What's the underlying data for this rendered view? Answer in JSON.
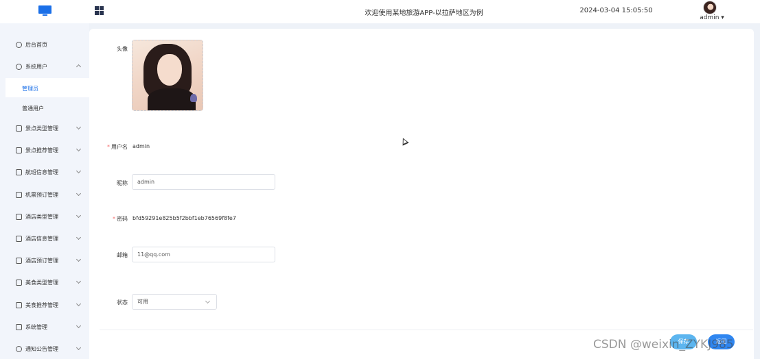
{
  "header": {
    "title": "欢迎使用某地旅游APP-以拉萨地区为例",
    "datetime": "2024-03-04 15:05:50",
    "user_name": "admin"
  },
  "sidebar": {
    "items": [
      {
        "label": "后台首页",
        "icon": "clock-icon",
        "expandable": false
      },
      {
        "label": "系统用户",
        "icon": "user-icon",
        "expandable": true,
        "expanded": true,
        "children": [
          {
            "label": "管理员",
            "active": true
          },
          {
            "label": "普通用户",
            "active": false
          }
        ]
      },
      {
        "label": "景点类型管理",
        "icon": "list-icon",
        "expandable": true
      },
      {
        "label": "景点推荐管理",
        "icon": "list-icon",
        "expandable": true
      },
      {
        "label": "航班信息管理",
        "icon": "list-icon",
        "expandable": true
      },
      {
        "label": "机票预订管理",
        "icon": "list-icon",
        "expandable": true
      },
      {
        "label": "酒店类型管理",
        "icon": "list-icon",
        "expandable": true
      },
      {
        "label": "酒店信息管理",
        "icon": "list-icon",
        "expandable": true
      },
      {
        "label": "酒店预订管理",
        "icon": "list-icon",
        "expandable": true
      },
      {
        "label": "美食类型管理",
        "icon": "list-icon",
        "expandable": true
      },
      {
        "label": "美食推荐管理",
        "icon": "list-icon",
        "expandable": true
      },
      {
        "label": "系统管理",
        "icon": "folder-icon",
        "expandable": true
      },
      {
        "label": "通知公告管理",
        "icon": "sun-icon",
        "expandable": true
      }
    ]
  },
  "form": {
    "avatar_label": "头像",
    "username_label": "用户名",
    "username_value": "admin",
    "nickname_label": "昵称",
    "nickname_value": "admin",
    "password_label": "密码",
    "password_value": "bfd59291e825b5f2bbf1eb76569f8fe7",
    "email_label": "邮箱",
    "email_value": "11@qq.com",
    "status_label": "状态",
    "status_value": "可用",
    "save_label": "保存",
    "back_label": "返回"
  },
  "watermark": "CSDN @weixin_ZYKJ985",
  "colors": {
    "accent": "#1a6fe8",
    "required": "#f56c6c",
    "save": "#5cb5ef",
    "back": "#2f86f0"
  }
}
